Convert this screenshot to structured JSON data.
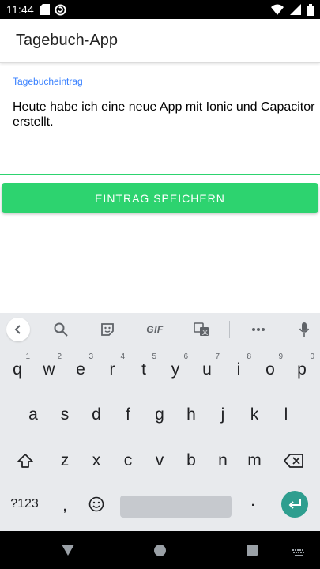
{
  "status_bar": {
    "time": "11:44",
    "left_icons": [
      "sd-card-icon",
      "sync-icon"
    ],
    "right_icons": [
      "wifi-icon",
      "signal-icon",
      "battery-icon"
    ]
  },
  "app_bar": {
    "title": "Tagebuch-App"
  },
  "entry": {
    "label": "Tagebucheintrag",
    "value": "Heute habe ich eine neue App mit Ionic und Capacitor erstellt."
  },
  "save_button": {
    "label": "EINTRAG SPEICHERN"
  },
  "keyboard": {
    "toolbar": {
      "gif_label": "GIF",
      "icons": [
        "back-chevron-icon",
        "search-icon",
        "sticker-icon",
        "gif-icon",
        "translate-icon",
        "more-icon",
        "mic-icon"
      ]
    },
    "row1": [
      {
        "key": "q",
        "hint": "1"
      },
      {
        "key": "w",
        "hint": "2"
      },
      {
        "key": "e",
        "hint": "3"
      },
      {
        "key": "r",
        "hint": "4"
      },
      {
        "key": "t",
        "hint": "5"
      },
      {
        "key": "y",
        "hint": "6"
      },
      {
        "key": "u",
        "hint": "7"
      },
      {
        "key": "i",
        "hint": "8"
      },
      {
        "key": "o",
        "hint": "9"
      },
      {
        "key": "p",
        "hint": "0"
      }
    ],
    "row2": [
      "a",
      "s",
      "d",
      "f",
      "g",
      "h",
      "j",
      "k",
      "l"
    ],
    "row3": [
      "z",
      "x",
      "c",
      "v",
      "b",
      "n",
      "m"
    ],
    "symbols_label": "?123",
    "comma": ",",
    "period": "."
  },
  "colors": {
    "accent_green": "#2dd36f",
    "label_blue": "#3880ff",
    "enter_teal": "#2e9e8f"
  }
}
